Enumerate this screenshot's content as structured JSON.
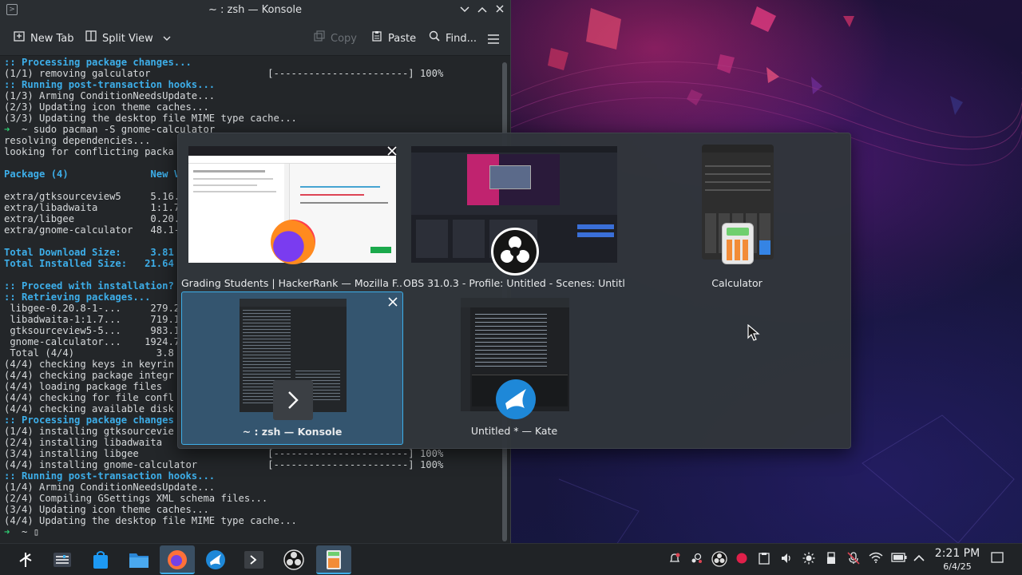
{
  "konsole": {
    "title": "~ : zsh — Konsole",
    "toolbar": {
      "new_tab": "New Tab",
      "split_view": "Split View",
      "copy": "Copy",
      "paste": "Paste",
      "find": "Find..."
    },
    "lines_a": [
      ":: Processing package changes...",
      "(1/1) removing galculator                    [-----------------------] 100%",
      ":: Running post-transaction hooks...",
      "(1/3) Arming ConditionNeedsUpdate...",
      "(2/3) Updating icon theme caches...",
      "(3/3) Updating the desktop file MIME type cache...",
      "➜  ~ sudo pacman -S gnome-calculator",
      "resolving dependencies...",
      "looking for conflicting packa",
      "",
      "Package (4)              New V",
      "",
      "extra/gtksourceview5     5.16.",
      "extra/libadwaita         1:1.7",
      "extra/libgee             0.20.",
      "extra/gnome-calculator   48.1-",
      "",
      "Total Download Size:     3.81",
      "Total Installed Size:   21.64",
      "",
      ":: Proceed with installation?",
      ":: Retrieving packages...",
      " libgee-0.20.8-1-...     279.2",
      " libadwaita-1:1.7...     719.1",
      " gtksourceview5-5...     983.1",
      " gnome-calculator...    1924.7",
      " Total (4/4)              3.8",
      "(4/4) checking keys in keyrin",
      "(4/4) checking package integr",
      "(4/4) loading package files",
      "(4/4) checking for file confl",
      "(4/4) checking available disk",
      ":: Processing package changes",
      "(1/4) installing gtksourcevie",
      "(2/4) installing libadwaita",
      "(3/4) installing libgee                      [-----------------------] 100%",
      "(4/4) installing gnome-calculator            [-----------------------] 100%",
      ":: Running post-transaction hooks...",
      "(1/4) Arming ConditionNeedsUpdate...",
      "(2/4) Compiling GSettings XML schema files...",
      "(3/4) Updating icon theme caches...",
      "(4/4) Updating the desktop file MIME type cache...",
      "➜  ~ ▯"
    ]
  },
  "switcher": {
    "items": [
      {
        "label": "Grading Students | HackerRank — Mozilla F..."
      },
      {
        "label": "OBS 31.0.3 - Profile: Untitled - Scenes: Untitl..."
      },
      {
        "label": "Calculator"
      },
      {
        "label": "~ : zsh — Konsole"
      },
      {
        "label": "Untitled * — Kate"
      }
    ]
  },
  "clock": {
    "time": "2:21 PM",
    "date": "6/4/25"
  },
  "colors": {
    "accent": "#3daee9",
    "panel": "#202326",
    "terminal_bg": "#232629"
  }
}
